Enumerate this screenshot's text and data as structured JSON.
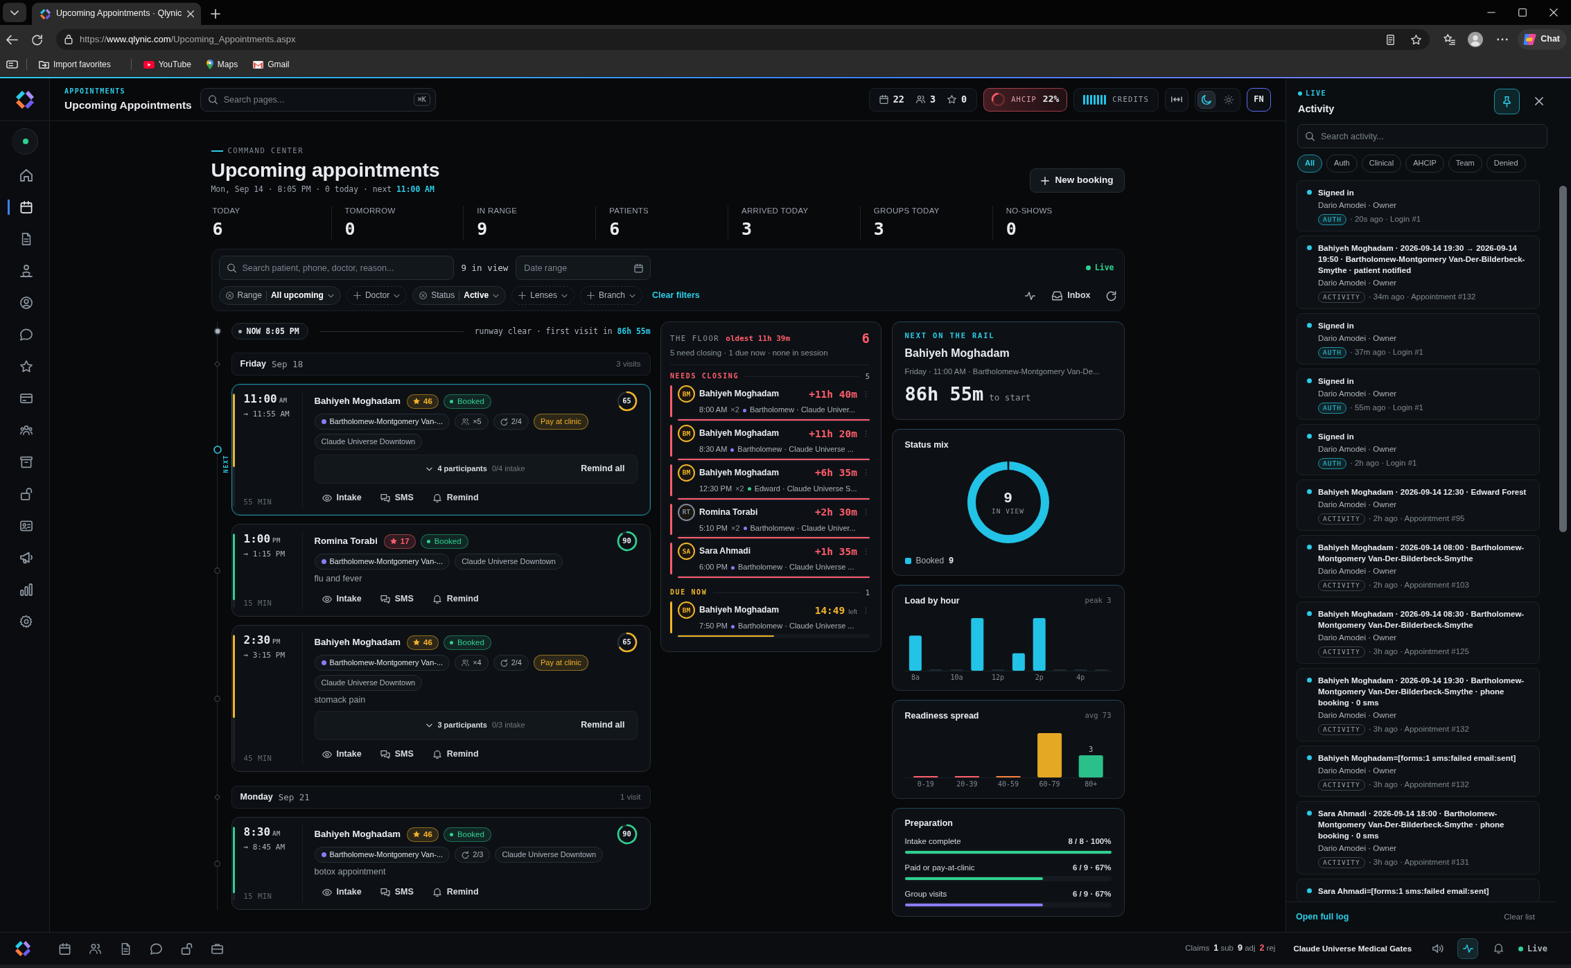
{
  "browser": {
    "tab_title": "Upcoming Appointments · Qlynic",
    "url": {
      "scheme": "https://",
      "host": "www.qlynic.com",
      "path": "/Upcoming_Appointments.aspx"
    },
    "bookmarks": [
      {
        "kind": "import",
        "label": "Import favorites"
      },
      {
        "kind": "youtube",
        "label": "YouTube"
      },
      {
        "kind": "maps",
        "label": "Maps"
      },
      {
        "kind": "gmail",
        "label": "Gmail"
      }
    ],
    "chat": "Chat"
  },
  "sidebar": {
    "status": {
      "online": true
    },
    "items": [
      {
        "kind": "home",
        "selected": false
      },
      {
        "kind": "calendar",
        "selected": true
      },
      {
        "kind": "document",
        "selected": false
      },
      {
        "kind": "org",
        "selected": false
      },
      {
        "kind": "user",
        "selected": false
      },
      {
        "kind": "chat",
        "selected": false
      },
      {
        "kind": "star",
        "selected": false
      },
      {
        "kind": "card",
        "selected": false
      },
      {
        "kind": "group",
        "selected": false
      },
      {
        "kind": "archive",
        "selected": false
      },
      {
        "kind": "lock",
        "selected": false
      },
      {
        "kind": "idcard",
        "selected": false
      },
      {
        "kind": "megaphone",
        "selected": false
      },
      {
        "kind": "chart",
        "selected": false
      },
      {
        "kind": "settings",
        "selected": false
      }
    ]
  },
  "header": {
    "section": "APPOINTMENTS",
    "title": "Upcoming Appointments",
    "search": {
      "placeholder": "Search pages...",
      "shortcut": "⌘K"
    },
    "counters": [
      {
        "kind": "calendar",
        "value": "22"
      },
      {
        "kind": "people",
        "value": "3"
      },
      {
        "kind": "star",
        "value": "0"
      }
    ],
    "ahcip": {
      "label": "AHCIP",
      "value": "22%"
    },
    "credits": {
      "label": "CREDITS"
    },
    "theme": [
      {
        "kind": "dark",
        "selected": true
      },
      {
        "kind": "light",
        "selected": false
      }
    ],
    "avatar": "FN"
  },
  "page": {
    "eyebrow": "COMMAND CENTER",
    "title": "Upcoming appointments",
    "subtitle": "Mon, Sep 14 · 8:05 PM · 0 today · next **11:00 AM**",
    "new_booking": "New booking"
  },
  "stats": [
    {
      "label": "TODAY",
      "value": "6"
    },
    {
      "label": "TOMORROW",
      "value": "0"
    },
    {
      "label": "IN RANGE",
      "value": "9"
    },
    {
      "label": "PATIENTS",
      "value": "6"
    },
    {
      "label": "ARRIVED TODAY",
      "value": "3"
    },
    {
      "label": "GROUPS TODAY",
      "value": "3"
    },
    {
      "label": "NO-SHOWS",
      "value": "0"
    }
  ],
  "filters": {
    "search_placeholder": "Search patient, phone, doctor, reason...",
    "in_view": "9 in view",
    "date_placeholder": "Date range",
    "live": "Live",
    "chips": [
      {
        "kind": "set",
        "label": "Range",
        "value": "All upcoming"
      },
      {
        "kind": "add",
        "label": "Doctor"
      },
      {
        "kind": "set",
        "label": "Status",
        "value": "Active"
      },
      {
        "kind": "add",
        "label": "Lenses"
      },
      {
        "kind": "add",
        "label": "Branch"
      }
    ],
    "clear": "Clear filters",
    "tools": [
      {
        "kind": "pulse"
      },
      {
        "kind": "inbox",
        "label": "Inbox"
      },
      {
        "kind": "refresh"
      }
    ]
  },
  "timeline": {
    "now": "NOW 8:05 PM",
    "runway": "runway clear · first visit in **86h 55m**",
    "next_label": "NEXT",
    "days": [
      {
        "weekday": "Friday",
        "date": "Sep 18",
        "count": "3 visits",
        "appointments": [
          {
            "time": "11:00",
            "meridiem": "AM",
            "until": "→ 11:55 AM",
            "duration": "55 MIN",
            "next": true,
            "name": "Bahiyeh Moghadam",
            "score": {
              "value": "46",
              "color": "#f2b42a"
            },
            "status": "Booked",
            "readiness": {
              "value": "65",
              "level": 0.65,
              "color": "#f2b42a"
            },
            "chips": [
              {
                "kind": "doctor",
                "label": "Bartholomew-Montgomery Van-...",
                "color": "#8b7cf6"
              },
              {
                "kind": "party",
                "label": "×5"
              },
              {
                "kind": "sessions",
                "label": "2/4"
              },
              {
                "kind": "payment",
                "label": "Pay at clinic"
              },
              {
                "kind": "location",
                "label": "Claude Universe Downtown"
              }
            ],
            "participants": {
              "count": "4 participants",
              "intake": "0/4 intake",
              "action": "Remind all"
            },
            "actions": [
              {
                "kind": "intake",
                "label": "Intake"
              },
              {
                "kind": "sms",
                "label": "SMS"
              },
              {
                "kind": "remind",
                "label": "Remind"
              }
            ]
          },
          {
            "time": "1:00",
            "meridiem": "PM",
            "until": "→ 1:15 PM",
            "duration": "15 MIN",
            "next": false,
            "name": "Romina Torabi",
            "score": {
              "value": "17",
              "color": "#ff5d6c"
            },
            "status": "Booked",
            "readiness": {
              "value": "90",
              "level": 0.9,
              "color": "#2fd191"
            },
            "chips": [
              {
                "kind": "doctor",
                "label": "Bartholomew-Montgomery Van-...",
                "color": "#8b7cf6"
              },
              {
                "kind": "location",
                "label": "Claude Universe Downtown"
              }
            ],
            "reason": "flu and fever",
            "actions": [
              {
                "kind": "intake",
                "label": "Intake"
              },
              {
                "kind": "sms",
                "label": "SMS"
              },
              {
                "kind": "remind",
                "label": "Remind"
              }
            ]
          },
          {
            "time": "2:30",
            "meridiem": "PM",
            "until": "→ 3:15 PM",
            "duration": "45 MIN",
            "next": false,
            "name": "Bahiyeh Moghadam",
            "score": {
              "value": "46",
              "color": "#f2b42a"
            },
            "status": "Booked",
            "readiness": {
              "value": "65",
              "level": 0.65,
              "color": "#f2b42a"
            },
            "chips": [
              {
                "kind": "doctor",
                "label": "Bartholomew-Montgomery Van-...",
                "color": "#8b7cf6"
              },
              {
                "kind": "party",
                "label": "×4"
              },
              {
                "kind": "sessions",
                "label": "2/4"
              },
              {
                "kind": "payment",
                "label": "Pay at clinic"
              },
              {
                "kind": "location",
                "label": "Claude Universe Downtown"
              }
            ],
            "reason": "stomack pain",
            "participants": {
              "count": "3 participants",
              "intake": "0/3 intake",
              "action": "Remind all"
            },
            "actions": [
              {
                "kind": "intake",
                "label": "Intake"
              },
              {
                "kind": "sms",
                "label": "SMS"
              },
              {
                "kind": "remind",
                "label": "Remind"
              }
            ]
          }
        ]
      },
      {
        "weekday": "Monday",
        "date": "Sep 21",
        "count": "1 visit",
        "appointments": [
          {
            "time": "8:30",
            "meridiem": "AM",
            "until": "→ 8:45 AM",
            "duration": "15 MIN",
            "next": false,
            "name": "Bahiyeh Moghadam",
            "score": {
              "value": "46",
              "color": "#f2b42a"
            },
            "status": "Booked",
            "readiness": {
              "value": "90",
              "level": 0.9,
              "color": "#2fd191"
            },
            "chips": [
              {
                "kind": "doctor",
                "label": "Bartholomew-Montgomery Van-...",
                "color": "#8b7cf6"
              },
              {
                "kind": "sessions",
                "label": "2/3"
              },
              {
                "kind": "location",
                "label": "Claude Universe Downtown"
              }
            ],
            "reason": "botox appointment",
            "actions": [
              {
                "kind": "intake",
                "label": "Intake"
              },
              {
                "kind": "sms",
                "label": "SMS"
              },
              {
                "kind": "remind",
                "label": "Remind"
              }
            ]
          }
        ]
      }
    ]
  },
  "floor": {
    "title": "THE FLOOR",
    "oldest": "oldest 11h 39m",
    "count": "6",
    "summary": "5 need closing · 1 due now · none in session",
    "groups": [
      {
        "label": "NEEDS CLOSING",
        "count": "5",
        "color": "#ff5d6c",
        "items": [
          {
            "avatar": {
              "initials": "BM",
              "color": "#f2b42a"
            },
            "name": "Bahiyeh Moghadam",
            "delay": "+11h 40m",
            "time": "8:00 AM",
            "multi": "×2",
            "doctor_dot": {
              "color": "#8b7cf6"
            },
            "place": "Bartholomew · Claude Univer...",
            "level": 1
          },
          {
            "avatar": {
              "initials": "BM",
              "color": "#f2b42a"
            },
            "name": "Bahiyeh Moghadam",
            "delay": "+11h 20m",
            "time": "8:30 AM",
            "doctor_dot": {
              "color": "#8b7cf6"
            },
            "place": "Bartholomew · Claude Universe ...",
            "level": 1
          },
          {
            "avatar": {
              "initials": "BM",
              "color": "#f2b42a"
            },
            "name": "Bahiyeh Moghadam",
            "delay": "+6h 35m",
            "time": "12:30 PM",
            "multi": "×2",
            "doctor_dot": {
              "color": "#2fd191"
            },
            "place": "Edward · Claude Universe S...",
            "level": 1
          },
          {
            "avatar": {
              "initials": "RT",
              "color": "#7d8a99"
            },
            "name": "Romina Torabi",
            "delay": "+2h 30m",
            "time": "5:10 PM",
            "multi": "×2",
            "doctor_dot": {
              "color": "#8b7cf6"
            },
            "place": "Bartholomew · Claude Univer...",
            "level": 1
          },
          {
            "avatar": {
              "initials": "SA",
              "color": "#f2b42a"
            },
            "name": "Sara Ahmadi",
            "delay": "+1h 35m",
            "time": "6:00 PM",
            "doctor_dot": {
              "color": "#8b7cf6"
            },
            "place": "Bartholomew · Claude Universe ...",
            "level": 1
          }
        ]
      },
      {
        "label": "DUE NOW",
        "count": "1",
        "color": "#f2b42a",
        "items": [
          {
            "avatar": {
              "initials": "BM",
              "color": "#f2b42a"
            },
            "name": "Bahiyeh Moghadam",
            "delay": "14:49",
            "delay_note": "left",
            "time": "7:50 PM",
            "doctor_dot": {
              "color": "#8b7cf6"
            },
            "place": "Bartholomew · Claude Universe ...",
            "level": 0.5
          }
        ]
      }
    ]
  },
  "next_on_rail": {
    "eyebrow": "NEXT ON THE RAIL",
    "name": "Bahiyeh Moghadam",
    "detail": "Friday · 11:00 AM · Bartholomew-Montgomery Van-De...",
    "countdown": "86h 55m",
    "suffix": "to start"
  },
  "status_mix": {
    "title": "Status mix",
    "center_value": "9",
    "center_label": "IN VIEW",
    "legend": [
      {
        "label": "Booked",
        "value": "9",
        "color": "#22c3e6"
      }
    ]
  },
  "load_by_hour": {
    "title": "Load by hour",
    "note": "peak 3",
    "x_labels": [
      "8a",
      "10a",
      "12p",
      "2p",
      "4p"
    ]
  },
  "readiness_spread": {
    "title": "Readiness spread",
    "note": "avg 73",
    "bins": [
      {
        "label": "0-19",
        "color": "#ff5d6c"
      },
      {
        "label": "20-39",
        "color": "#ff5d6c"
      },
      {
        "label": "40-59",
        "color": "#f5803e"
      },
      {
        "label": "60-79",
        "color": "#e5a823"
      },
      {
        "label": "80+",
        "color": "#2bbf8a",
        "value_label": "3"
      }
    ]
  },
  "preparation": {
    "title": "Preparation",
    "rows": [
      {
        "label": "Intake complete",
        "value": "8 / 8 · 100%",
        "level": 1,
        "color": "#2fd191"
      },
      {
        "label": "Paid or pay-at-clinic",
        "value": "6 / 9 · 67%",
        "level": 0.67,
        "color": "#2fd191"
      },
      {
        "label": "Group visits",
        "value": "6 / 9 · 67%",
        "level": 0.67,
        "color": "#8b7cf6"
      }
    ]
  },
  "activity": {
    "live": "LIVE",
    "title": "Activity",
    "pinned": true,
    "search_placeholder": "Search activity...",
    "filters": [
      {
        "label": "All",
        "selected": true
      },
      {
        "label": "Auth",
        "selected": false
      },
      {
        "label": "Clinical",
        "selected": false
      },
      {
        "label": "AHCIP",
        "selected": false
      },
      {
        "label": "Team",
        "selected": false
      },
      {
        "label": "Denied",
        "selected": false
      }
    ],
    "entries": [
      {
        "title": "Signed in",
        "actor": "Dario Amodei · Owner",
        "tag": {
          "kind": "auth",
          "label": "AUTH"
        },
        "meta": "· 20s ago · Login #1"
      },
      {
        "title": "Bahiyeh Moghadam · 2026-09-14 19:30 → 2026-09-14 19:50 · Bartholomew-Montgomery Van-Der-Bilderbeck-Smythe · patient notified",
        "actor": "Dario Amodei · Owner",
        "tag": {
          "kind": "activity",
          "label": "ACTIVITY"
        },
        "meta": "· 34m ago · Appointment #132"
      },
      {
        "title": "Signed in",
        "actor": "Dario Amodei · Owner",
        "tag": {
          "kind": "auth",
          "label": "AUTH"
        },
        "meta": "· 37m ago · Login #1"
      },
      {
        "title": "Signed in",
        "actor": "Dario Amodei · Owner",
        "tag": {
          "kind": "auth",
          "label": "AUTH"
        },
        "meta": "· 55m ago · Login #1"
      },
      {
        "title": "Signed in",
        "actor": "Dario Amodei · Owner",
        "tag": {
          "kind": "auth",
          "label": "AUTH"
        },
        "meta": "· 2h ago · Login #1"
      },
      {
        "title": "Bahiyeh Moghadam · 2026-09-14 12:30 · Edward Forest",
        "actor": "Dario Amodei · Owner",
        "tag": {
          "kind": "activity",
          "label": "ACTIVITY"
        },
        "meta": "· 2h ago · Appointment #95"
      },
      {
        "title": "Bahiyeh Moghadam · 2026-09-14 08:00 · Bartholomew-Montgomery Van-Der-Bilderbeck-Smythe",
        "actor": "Dario Amodei · Owner",
        "tag": {
          "kind": "activity",
          "label": "ACTIVITY"
        },
        "meta": "· 2h ago · Appointment #103"
      },
      {
        "title": "Bahiyeh Moghadam · 2026-09-14 08:30 · Bartholomew-Montgomery Van-Der-Bilderbeck-Smythe",
        "actor": "Dario Amodei · Owner",
        "tag": {
          "kind": "activity",
          "label": "ACTIVITY"
        },
        "meta": "· 3h ago · Appointment #125"
      },
      {
        "title": "Bahiyeh Moghadam · 2026-09-14 19:30 · Bartholomew-Montgomery Van-Der-Bilderbeck-Smythe · phone booking · 0 sms",
        "actor": "Dario Amodei · Owner",
        "tag": {
          "kind": "activity",
          "label": "ACTIVITY"
        },
        "meta": "· 3h ago · Appointment #132"
      },
      {
        "title": "Bahiyeh Moghadam=[forms:1 sms:failed email:sent]",
        "actor": "Dario Amodei · Owner",
        "tag": {
          "kind": "activity",
          "label": "ACTIVITY"
        },
        "meta": "· 3h ago · Appointment #132"
      },
      {
        "title": "Sara Ahmadi · 2026-09-14 18:00 · Bartholomew-Montgomery Van-Der-Bilderbeck-Smythe · phone booking · 0 sms",
        "actor": "Dario Amodei · Owner",
        "tag": {
          "kind": "activity",
          "label": "ACTIVITY"
        },
        "meta": "· 3h ago · Appointment #131"
      },
      {
        "title": "Sara Ahmadi=[forms:1 sms:failed email:sent]"
      }
    ],
    "open_log": "Open full log",
    "clear": "Clear list"
  },
  "bottom_bar": {
    "nav": [
      {
        "kind": "calendar"
      },
      {
        "kind": "people"
      },
      {
        "kind": "document"
      },
      {
        "kind": "chat"
      },
      {
        "kind": "lock"
      },
      {
        "kind": "briefcase"
      }
    ],
    "claims": {
      "label": "Claims",
      "counts": [
        {
          "text": "**1** sub",
          "color": "#e8ebef"
        },
        {
          "text": "**9** adj",
          "color": "#e8ebef"
        },
        {
          "text": "**2** rej",
          "color": "#ff5d6c"
        }
      ]
    },
    "org": "Claude Universe Medical Gates",
    "tools": [
      {
        "kind": "speaker",
        "selected": false
      },
      {
        "kind": "pulse",
        "selected": true
      },
      {
        "kind": "bell",
        "selected": false
      }
    ],
    "live": "Live"
  }
}
